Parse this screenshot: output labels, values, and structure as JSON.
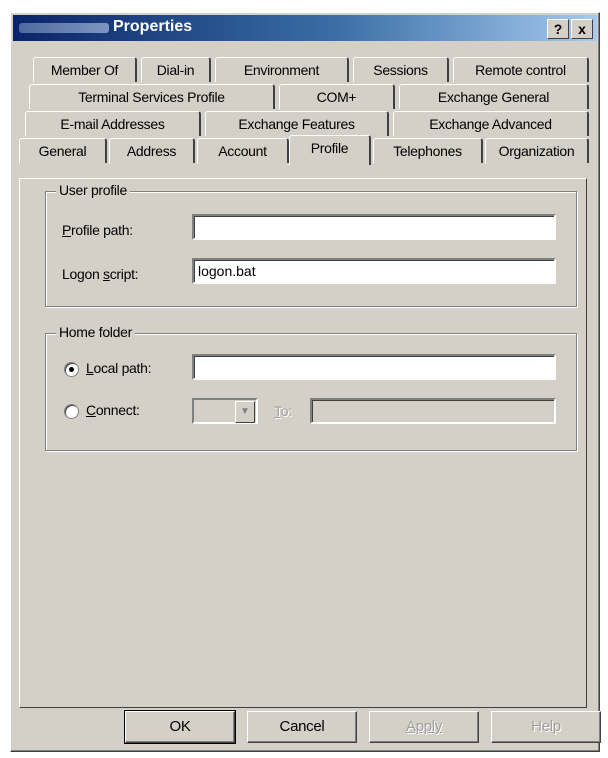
{
  "window": {
    "title": "Properties",
    "help_button": "?",
    "close_button": "x"
  },
  "tabs": {
    "row1": [
      "Member Of",
      "Dial-in",
      "Environment",
      "Sessions",
      "Remote control"
    ],
    "row2": [
      "Terminal Services Profile",
      "COM+",
      "Exchange General"
    ],
    "row3": [
      "E-mail Addresses",
      "Exchange Features",
      "Exchange Advanced"
    ],
    "row4": [
      "General",
      "Address",
      "Account",
      "Profile",
      "Telephones",
      "Organization"
    ],
    "active": "Profile"
  },
  "user_profile": {
    "group_title": "User profile",
    "profile_path_label": "Profile path:",
    "profile_path_value": "",
    "logon_script_label": "Logon script:",
    "logon_script_value": "logon.bat"
  },
  "home_folder": {
    "group_title": "Home folder",
    "local_path_label": "Local path:",
    "local_path_value": "",
    "local_path_selected": true,
    "connect_label": "Connect:",
    "connect_selected": false,
    "to_label": "To:",
    "to_value": ""
  },
  "buttons": {
    "ok": "OK",
    "cancel": "Cancel",
    "apply": "Apply",
    "help": "Help"
  }
}
